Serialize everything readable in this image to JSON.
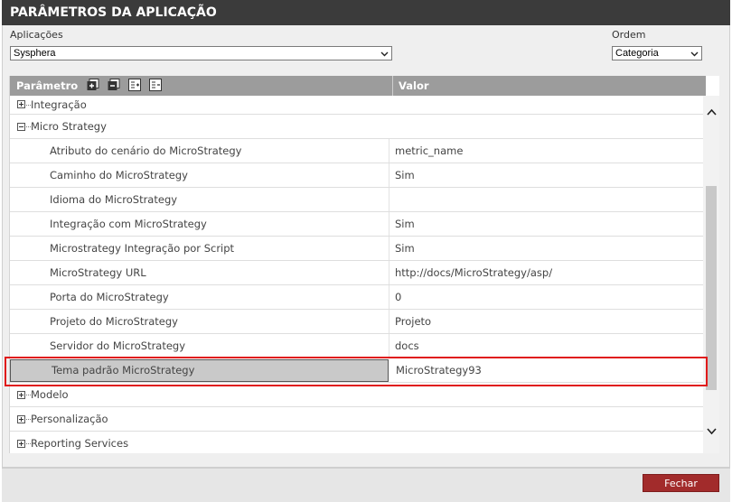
{
  "window": {
    "title": "PARÂMETROS DA APLICAÇÃO"
  },
  "filters": {
    "applications_label": "Aplicações",
    "applications_value": "Sysphera",
    "order_label": "Ordem",
    "order_value": "Categoria"
  },
  "grid": {
    "col_param": "Parâmetro",
    "col_value": "Valor",
    "header_icons": [
      "expand-all-icon",
      "collapse-all-icon",
      "add-row-icon",
      "edit-row-icon"
    ],
    "rows": [
      {
        "label": "Integração",
        "value": ""
      },
      {
        "label": "Micro Strategy",
        "value": ""
      },
      {
        "label": "Atributo do cenário do MicroStrategy",
        "value": "metric_name"
      },
      {
        "label": "Caminho do MicroStrategy",
        "value": "Sim"
      },
      {
        "label": "Idioma do MicroStrategy",
        "value": ""
      },
      {
        "label": "Integração com MicroStrategy",
        "value": "Sim"
      },
      {
        "label": "Microstrategy Integração por Script",
        "value": "Sim"
      },
      {
        "label": "MicroStrategy URL",
        "value": "http://docs/MicroStrategy/asp/"
      },
      {
        "label": "Porta do MicroStrategy",
        "value": "0"
      },
      {
        "label": "Projeto do MicroStrategy",
        "value": "Projeto"
      },
      {
        "label": "Servidor do MicroStrategy",
        "value": "docs"
      },
      {
        "label": "Tema padrão MicroStrategy",
        "value": "MicroStrategy93"
      },
      {
        "label": "Modelo",
        "value": ""
      },
      {
        "label": "Personalização",
        "value": ""
      },
      {
        "label": "Reporting Services",
        "value": ""
      }
    ]
  },
  "footer": {
    "close_label": "Fechar"
  },
  "colors": {
    "title_bg": "#3b3b3b",
    "header_bg": "#9c9c9c",
    "button_bg": "#a22b2b",
    "highlight": "#e01b1b"
  }
}
